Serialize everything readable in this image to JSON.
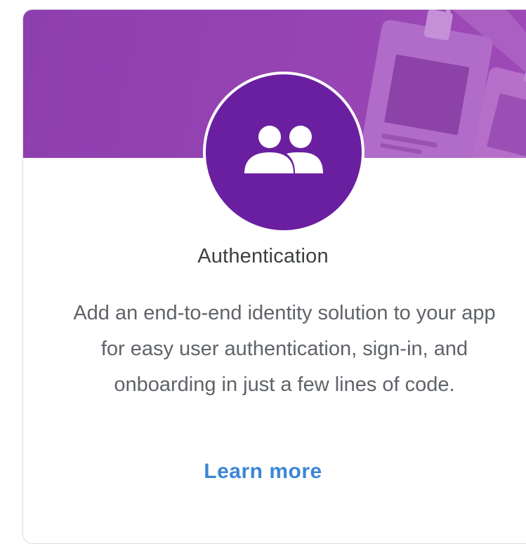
{
  "card": {
    "title": "Authentication",
    "description": "Add an end-to-end identity solution to your app for easy user authentication, sign-in, and onboarding in just a few lines of code.",
    "cta_label": "Learn more",
    "icon": "people-icon",
    "banner_art": "id-badge-illustration"
  },
  "colors": {
    "banner": "#9643b3",
    "icon_circle": "#6a1fa0",
    "title": "#3c4043",
    "description": "#5f6368",
    "link": "#3b86d6"
  }
}
